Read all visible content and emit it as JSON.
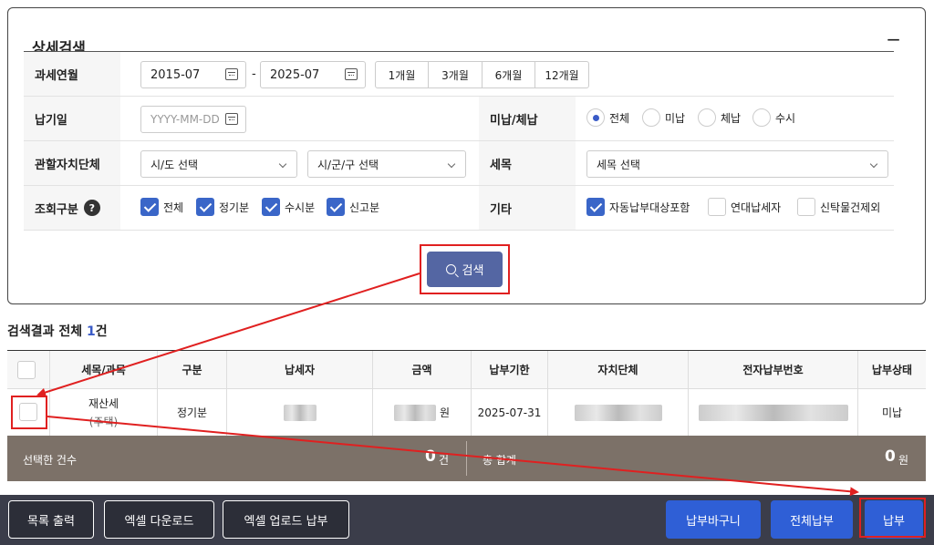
{
  "panel": {
    "title": "상세검색",
    "collapse_icon": "−"
  },
  "filters": {
    "tax_month_label": "과세연월",
    "start_month": "2015-07",
    "dash": "-",
    "end_month": "2025-07",
    "ranges": [
      "1개월",
      "3개월",
      "6개월",
      "12개월"
    ],
    "due_date_label": "납기일",
    "due_date_placeholder": "YYYY-MM-DD",
    "status_label": "미납/체납",
    "status_options": [
      "전체",
      "미납",
      "체납",
      "수시"
    ],
    "status_selected": "전체",
    "region_label": "관할자치단체",
    "sido_placeholder": "시/도 선택",
    "sigungu_placeholder": "시/군/구 선택",
    "tax_item_label": "세목",
    "tax_item_placeholder": "세목 선택",
    "query_type_label": "조회구분",
    "help_icon": "?",
    "query_types": [
      "전체",
      "정기분",
      "수시분",
      "신고분"
    ],
    "etc_label": "기타",
    "etc_options": [
      "자동납부대상포함",
      "연대납세자",
      "신탁물건제외"
    ]
  },
  "search_button": "검색",
  "results": {
    "prefix": "검색결과 전체 ",
    "count": "1",
    "suffix": "건"
  },
  "table": {
    "headers": [
      "세목/과목",
      "구분",
      "납세자",
      "금액",
      "납부기한",
      "자치단체",
      "전자납부번호",
      "납부상태"
    ],
    "rows": [
      {
        "item_line1": "재산세",
        "item_line2": "(주택)",
        "type": "정기분",
        "amount_unit": "원",
        "due": "2025-07-31",
        "status": "미납"
      }
    ]
  },
  "summary": {
    "selected_label": "선택한 건수",
    "selected_count": "0",
    "count_unit": "건",
    "total_label": "총 합계",
    "total_amount": "0",
    "amount_unit": "원"
  },
  "bottom": {
    "print_list": "목록 출력",
    "excel_download": "엑셀 다운로드",
    "excel_upload_pay": "엑셀 업로드 납부",
    "cart": "납부바구니",
    "pay_all": "전체납부",
    "pay": "납부"
  },
  "colors": {
    "accent_blue": "#2f5fd6",
    "search_button": "#5466a3",
    "annotation_red": "#e02020",
    "summary_bar": "#7c7168",
    "bottom_bar": "#3b3d4a"
  }
}
